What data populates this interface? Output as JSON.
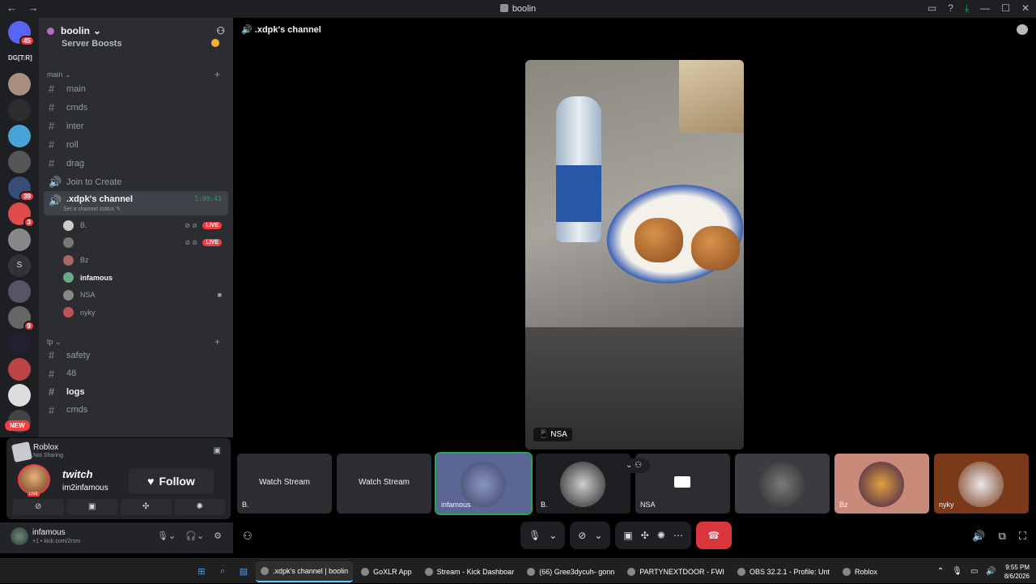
{
  "window": {
    "title": "boolin",
    "back": "←",
    "forward": "→"
  },
  "server": {
    "name": "boolin",
    "boosts_label": "Server Boosts"
  },
  "guilds": [
    {
      "badge": "45"
    },
    {
      "text": "DG[T:R]"
    },
    {},
    {},
    {},
    {},
    {
      "badge": "39"
    },
    {
      "badge": "3"
    },
    {},
    {
      "letter": "S"
    },
    {},
    {
      "badge": "9"
    },
    {},
    {},
    {},
    {}
  ],
  "new_label": "NEW",
  "categories": {
    "main": "main",
    "tp": "tp"
  },
  "channels_main": [
    {
      "name": "main",
      "type": "text"
    },
    {
      "name": "cmds",
      "type": "text"
    },
    {
      "name": "inter",
      "type": "text"
    },
    {
      "name": "roll",
      "type": "text"
    },
    {
      "name": "drag",
      "type": "text"
    },
    {
      "name": "Join to Create",
      "type": "voice"
    }
  ],
  "active_voice": {
    "name": ".xdpk's channel",
    "timer": "1:00:41",
    "status": "Set a channel status"
  },
  "voice_users": [
    {
      "name": "B.",
      "live": "LIVE"
    },
    {
      "name": "",
      "live": "LIVE"
    },
    {
      "name": "Bz"
    },
    {
      "name": "infamous",
      "bold": true
    },
    {
      "name": "NSA",
      "camera": true
    },
    {
      "name": "nyky"
    }
  ],
  "channels_tp": [
    {
      "name": "safety"
    },
    {
      "name": "48"
    },
    {
      "name": "logs",
      "bold": true
    },
    {
      "name": "cmds"
    }
  ],
  "activity": {
    "app": "Roblox",
    "sub": "Not Sharing",
    "twitch_logo": "twitch",
    "twitch_user": "im2infamous",
    "live": "LIVE",
    "follow": "Follow"
  },
  "user": {
    "name": "infamous",
    "status": "+1 • kick.com/2rsm"
  },
  "stage": {
    "channel": ".xdpk's channel",
    "main_video_label": "NSA"
  },
  "tiles": [
    {
      "label": "B.",
      "watch": "Watch Stream"
    },
    {
      "label": "",
      "watch": "Watch Stream"
    },
    {
      "label": "infamous",
      "speaking": true
    },
    {
      "label": "B."
    },
    {
      "label": "NSA",
      "camera_off": true
    },
    {
      "label": ""
    },
    {
      "label": "Bz"
    },
    {
      "label": "nyky"
    }
  ],
  "taskbar": {
    "apps": [
      {
        "label": ".xdpk's channel | boolin",
        "active": true
      },
      {
        "label": "GoXLR App"
      },
      {
        "label": "Stream - Kick Dashboar"
      },
      {
        "label": "(66) Gree3dycuh- gonn"
      },
      {
        "label": "PARTYNEXTDOOR - FWI"
      },
      {
        "label": "OBS 32.2.1 - Profile: Unt"
      },
      {
        "label": "Roblox"
      }
    ],
    "time": "9:55 PM",
    "date": "8/6/2026"
  }
}
